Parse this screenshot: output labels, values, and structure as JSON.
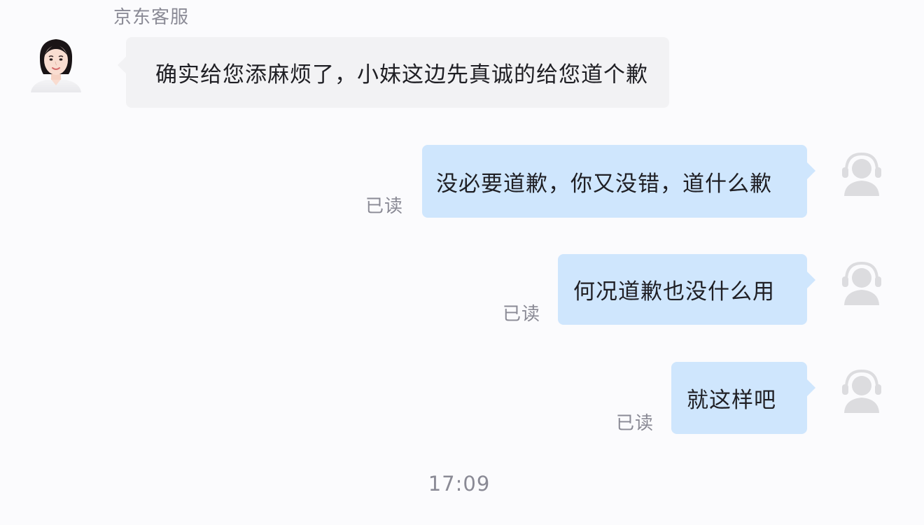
{
  "header": {
    "agent_name": "京东客服"
  },
  "messages": [
    {
      "direction": "incoming",
      "text": "确实给您添麻烦了，小妹这边先真诚的给您道个歉",
      "avatar_icon": "female-agent-avatar-icon"
    },
    {
      "direction": "outgoing",
      "text": "没必要道歉，你又没错，道什么歉",
      "status": "已读",
      "avatar_icon": "headset-user-avatar-icon"
    },
    {
      "direction": "outgoing",
      "text": "何况道歉也没什么用",
      "status": "已读",
      "avatar_icon": "headset-user-avatar-icon"
    },
    {
      "direction": "outgoing",
      "text": "就这样吧",
      "status": "已读",
      "avatar_icon": "headset-user-avatar-icon"
    }
  ],
  "footer": {
    "timestamp": "17:09"
  },
  "colors": {
    "background": "#fbfbfd",
    "incoming_bubble": "#f2f2f4",
    "outgoing_bubble": "#cfe6fd",
    "meta_text": "#8a8a95",
    "avatar_gray": "#dcdcdf"
  }
}
